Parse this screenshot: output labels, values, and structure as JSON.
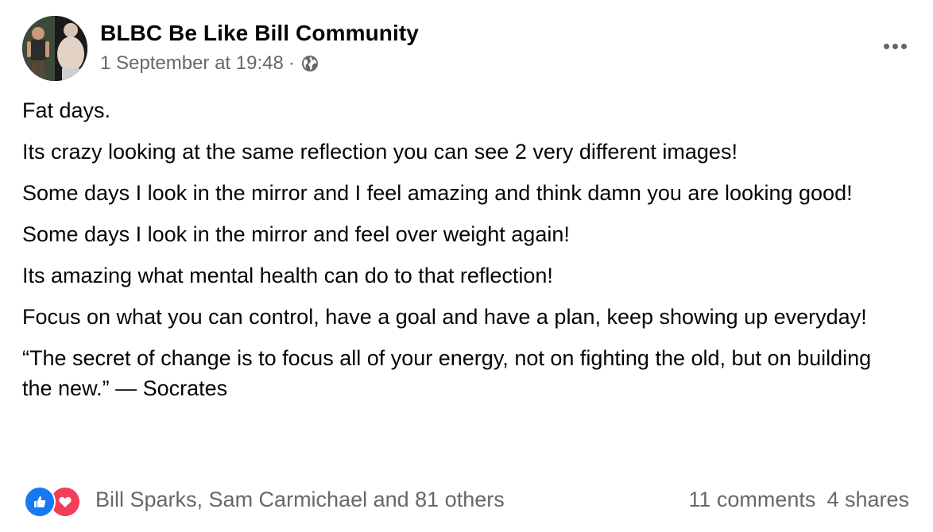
{
  "post": {
    "group_name": "BLBC Be Like Bill Community",
    "timestamp": "1 September at 19:48",
    "separator": "·",
    "privacy_icon": "globe-icon",
    "more_icon": "more-options-icon",
    "paragraphs": [
      "Fat days.",
      "Its crazy looking at the same reflection you can see 2 very different images!",
      "Some days I look in the mirror and I feel amazing and think damn you are looking good!",
      "Some days I look in the mirror and feel over weight again!",
      "Its amazing what mental health can do to that reflection!",
      "Focus on what you can control,  have a goal and have a plan, keep showing up everyday!",
      "“The secret of change is to focus all of your energy, not on fighting the old, but on building the new.” — Socrates"
    ],
    "reactions": {
      "icons": [
        "like-reaction-icon",
        "love-reaction-icon"
      ],
      "reacted_by": "Bill Sparks, Sam Carmichael and 81 others"
    },
    "comments": "11 comments",
    "shares": "4 shares",
    "colors": {
      "like": "#1877f2",
      "love": "#f33e58",
      "secondary_text": "#65676b",
      "primary_text": "#050505"
    }
  }
}
